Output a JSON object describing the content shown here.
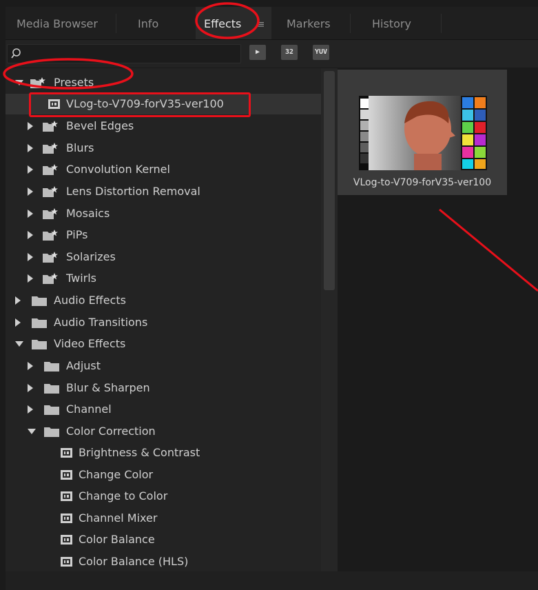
{
  "tabs": [
    {
      "label": "Media Browser"
    },
    {
      "label": "Info"
    },
    {
      "label": "Effects",
      "menu": "≡"
    },
    {
      "label": "Markers"
    },
    {
      "label": "History"
    }
  ],
  "search": {
    "placeholder": "",
    "value": ""
  },
  "filters": [
    {
      "label": "▶"
    },
    {
      "label": "32"
    },
    {
      "label": "YUV"
    }
  ],
  "tree": {
    "presets": {
      "label": "Presets",
      "items": [
        {
          "label": "VLog-to-V709-forV35-ver100"
        },
        {
          "label": "Bevel Edges"
        },
        {
          "label": "Blurs"
        },
        {
          "label": "Convolution Kernel"
        },
        {
          "label": "Lens Distortion Removal"
        },
        {
          "label": "Mosaics"
        },
        {
          "label": "PiPs"
        },
        {
          "label": "Solarizes"
        },
        {
          "label": "Twirls"
        }
      ]
    },
    "audio_effects": "Audio Effects",
    "audio_transitions": "Audio Transitions",
    "video_effects": {
      "label": "Video Effects",
      "folders": [
        "Adjust",
        "Blur & Sharpen",
        "Channel"
      ],
      "color_correction": {
        "label": "Color Correction",
        "items": [
          "Brightness & Contrast",
          "Change Color",
          "Change to Color",
          "Channel Mixer",
          "Color Balance",
          "Color Balance (HLS)"
        ]
      }
    }
  },
  "preview": {
    "label": "VLog-to-V709-forV35-ver100"
  },
  "colors": {
    "annotation": "#e8101a",
    "panel": "#232323",
    "selected": "#333333"
  }
}
